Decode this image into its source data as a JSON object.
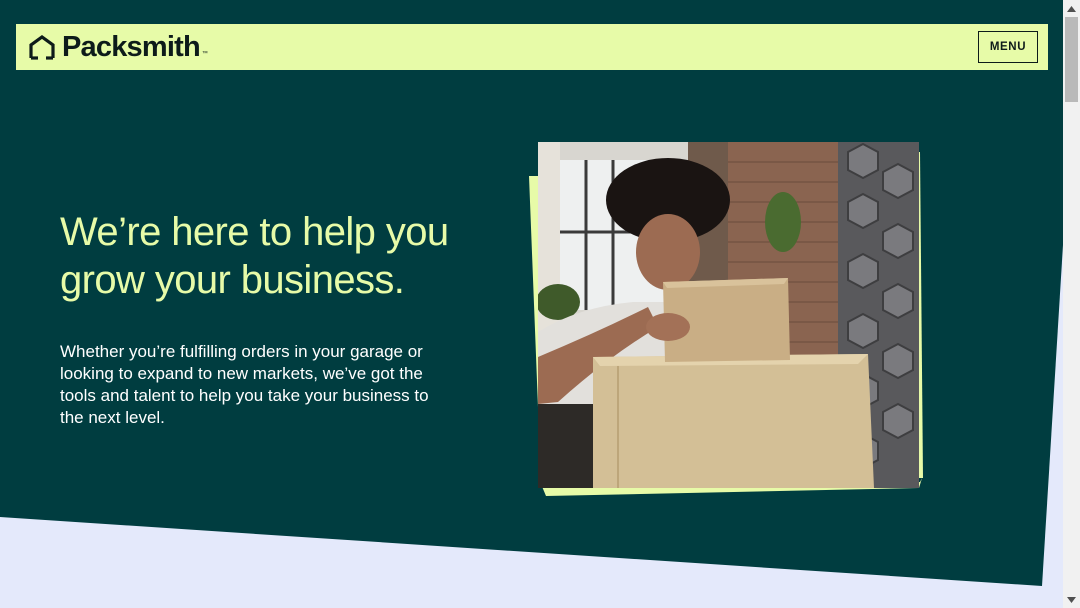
{
  "brand": {
    "name": "Packsmith",
    "trademark": "™"
  },
  "header": {
    "menu_label": "MENU"
  },
  "hero": {
    "headline": "We’re here to help you grow your business.",
    "subtext": "Whether you’re fulfilling orders in your garage or looking to expand to new markets, we’ve got the tools and talent to help you take your business to the next level.",
    "image_alt": "Woman holding cardboard boxes"
  },
  "colors": {
    "dark_teal": "#003d40",
    "lime": "#e7fba8",
    "lavender": "#e4e9fb",
    "ink": "#0d1b1a"
  },
  "icons": {
    "logo": "house-outline-icon",
    "scroll_up": "triangle-up-icon",
    "scroll_down": "triangle-down-icon"
  }
}
